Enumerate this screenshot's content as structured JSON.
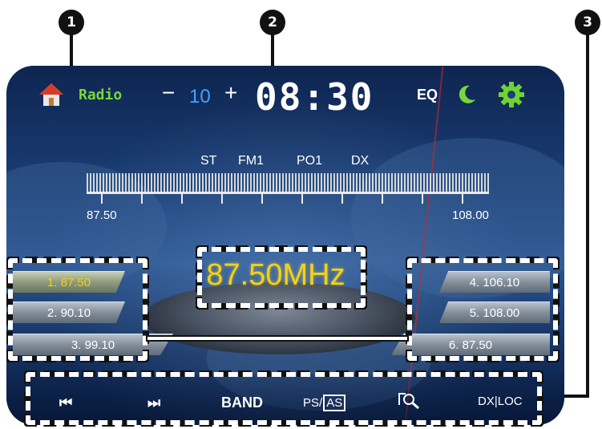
{
  "callouts": [
    "1",
    "2",
    "3"
  ],
  "header": {
    "app_label": "Radio",
    "volume_minus": "−",
    "volume_value": "10",
    "volume_plus": "+",
    "clock": "08:30",
    "eq_label": "EQ"
  },
  "tuner": {
    "tags": [
      "ST",
      "FM1",
      "PO1",
      "DX"
    ],
    "scale_min": "87.50",
    "scale_max": "108.00",
    "frequency": "87.50MHz"
  },
  "presets_left": [
    {
      "label": "1.  87.50",
      "active": true
    },
    {
      "label": "2.  90.10",
      "active": false
    },
    {
      "label": "3.  99.10",
      "active": false
    }
  ],
  "presets_right": [
    {
      "label": "4.  106.10",
      "active": false
    },
    {
      "label": "5.  108.00",
      "active": false
    },
    {
      "label": "6.  87.50",
      "active": false
    }
  ],
  "controls": {
    "prev": "⏮",
    "next": "⏭",
    "band": "BAND",
    "ps": "PS/",
    "as": "AS",
    "dxloc": "DX|LOC"
  },
  "icons": {
    "home": "home-icon",
    "moon": "moon-icon",
    "settings": "gear-icon",
    "scan": "search-scan-icon"
  },
  "colors": {
    "accent_green": "#7ad63a",
    "volume_blue": "#3fa3ff",
    "frequency_yellow": "#f3d11a"
  }
}
